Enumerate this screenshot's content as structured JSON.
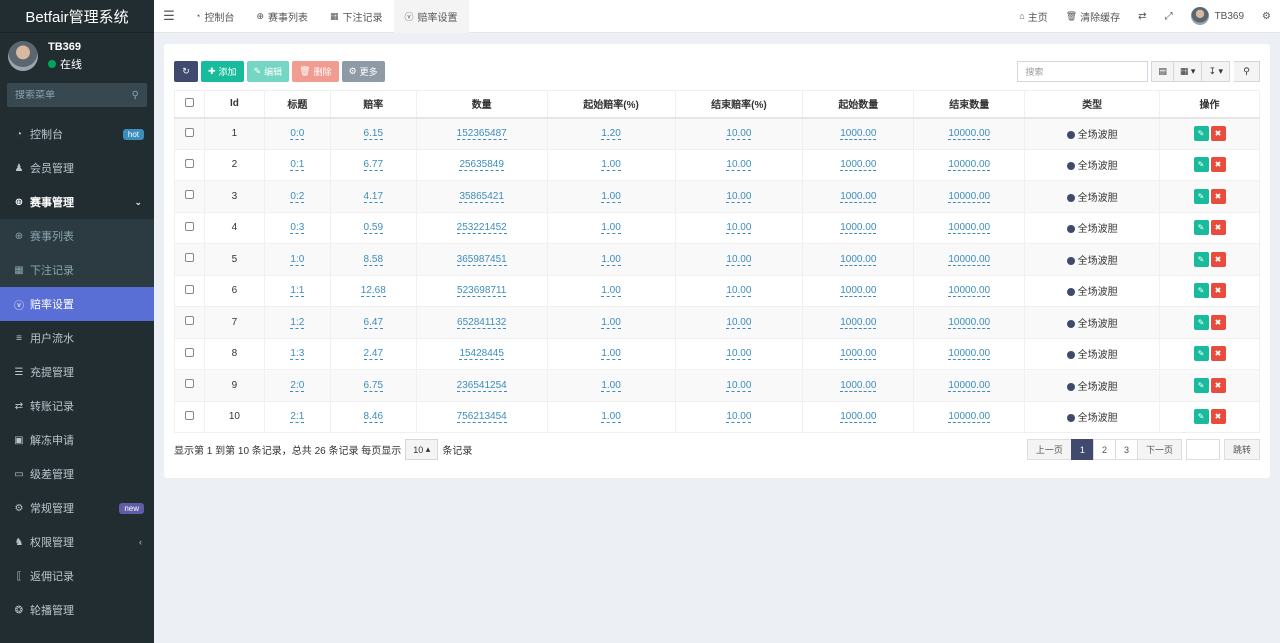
{
  "app": {
    "brand": "Betfair管理系统"
  },
  "user": {
    "name": "TB369",
    "status": "在线"
  },
  "sidebar": {
    "search_placeholder": "搜索菜单",
    "items": [
      {
        "label": "控制台",
        "icon": "dashboard-icon",
        "badge": "hot"
      },
      {
        "label": "会员管理",
        "icon": "users-icon"
      },
      {
        "label": "赛事管理",
        "icon": "circle-icon",
        "expanded": true
      },
      {
        "label": "赛事列表",
        "icon": "circle-icon",
        "sub": true
      },
      {
        "label": "下注记录",
        "icon": "calendar-icon",
        "sub": true
      },
      {
        "label": "赔率设置",
        "icon": "vk-icon",
        "sub": true,
        "active": true
      },
      {
        "label": "用户流水",
        "icon": "list-icon"
      },
      {
        "label": "充提管理",
        "icon": "list-alt-icon"
      },
      {
        "label": "转账记录",
        "icon": "transfer-icon"
      },
      {
        "label": "解冻申请",
        "icon": "image-icon"
      },
      {
        "label": "级差管理",
        "icon": "window-icon"
      },
      {
        "label": "常规管理",
        "icon": "cogs-icon",
        "badge": "new"
      },
      {
        "label": "权限管理",
        "icon": "group-icon"
      },
      {
        "label": "返佣记录",
        "icon": "bracket-icon"
      },
      {
        "label": "轮播管理",
        "icon": "award-icon"
      }
    ]
  },
  "topbar": {
    "tabs": [
      {
        "label": "控制台",
        "icon": "dashboard-icon"
      },
      {
        "label": "赛事列表",
        "icon": "circle-icon"
      },
      {
        "label": "下注记录",
        "icon": "calendar-icon"
      },
      {
        "label": "赔率设置",
        "icon": "vk-icon",
        "active": true
      }
    ],
    "home": "主页",
    "clear_cache": "清除缓存",
    "username": "TB369"
  },
  "toolbar": {
    "add": "添加",
    "edit": "编辑",
    "delete": "删除",
    "more": "更多",
    "search_placeholder": "搜索"
  },
  "table": {
    "headers": [
      "Id",
      "标题",
      "赔率",
      "数量",
      "起始赔率(%)",
      "结束赔率(%)",
      "起始数量",
      "结束数量",
      "类型",
      "操作"
    ],
    "rows": [
      [
        "1",
        "0:0",
        "6.15",
        "152365487",
        "1.20",
        "10.00",
        "1000.00",
        "10000.00",
        "全场波胆"
      ],
      [
        "2",
        "0:1",
        "6.77",
        "25635849",
        "1.00",
        "10.00",
        "1000.00",
        "10000.00",
        "全场波胆"
      ],
      [
        "3",
        "0:2",
        "4.17",
        "35865421",
        "1.00",
        "10.00",
        "1000.00",
        "10000.00",
        "全场波胆"
      ],
      [
        "4",
        "0:3",
        "0.59",
        "253221452",
        "1.00",
        "10.00",
        "1000.00",
        "10000.00",
        "全场波胆"
      ],
      [
        "5",
        "1:0",
        "8.58",
        "365987451",
        "1.00",
        "10.00",
        "1000.00",
        "10000.00",
        "全场波胆"
      ],
      [
        "6",
        "1:1",
        "12.68",
        "523698711",
        "1.00",
        "10.00",
        "1000.00",
        "10000.00",
        "全场波胆"
      ],
      [
        "7",
        "1:2",
        "6.47",
        "652841132",
        "1.00",
        "10.00",
        "1000.00",
        "10000.00",
        "全场波胆"
      ],
      [
        "8",
        "1:3",
        "2.47",
        "15428445",
        "1.00",
        "10.00",
        "1000.00",
        "10000.00",
        "全场波胆"
      ],
      [
        "9",
        "2:0",
        "6.75",
        "236541254",
        "1.00",
        "10.00",
        "1000.00",
        "10000.00",
        "全场波胆"
      ],
      [
        "10",
        "2:1",
        "8.46",
        "756213454",
        "1.00",
        "10.00",
        "1000.00",
        "10000.00",
        "全场波胆"
      ]
    ]
  },
  "footer": {
    "info_before": "显示第 1 到第 10 条记录，总共 26 条记录 每页显示",
    "page_size": "10",
    "info_after": "条记录"
  },
  "pager": {
    "prev": "上一页",
    "pages": [
      "1",
      "2",
      "3"
    ],
    "next": "下一页",
    "jump": "跳转"
  }
}
